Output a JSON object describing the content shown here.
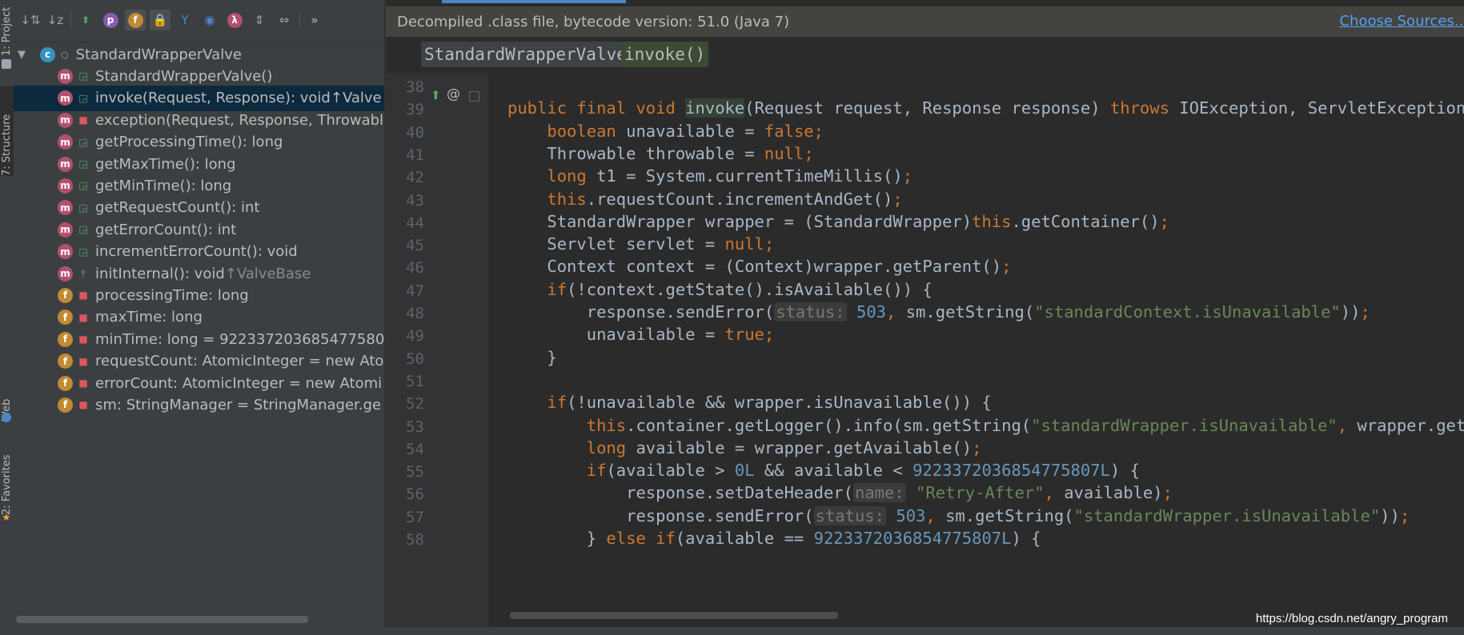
{
  "side_tabs": {
    "project": "1: Project",
    "structure": "7: Structure",
    "web": "Web",
    "favorites": "2: Favorites"
  },
  "structure_toolbar": [
    {
      "name": "sort-by-visibility-icon",
      "glyph": "↓⇅"
    },
    {
      "name": "sort-alphabetically-icon",
      "glyph": "↓z"
    },
    {
      "name": "show-inherited-icon",
      "glyph": "⬆"
    },
    {
      "name": "show-properties-icon",
      "glyph": "p"
    },
    {
      "name": "show-fields-icon",
      "glyph": "f"
    },
    {
      "name": "show-non-public-icon",
      "glyph": "🔒"
    },
    {
      "name": "show-anonymous-icon",
      "glyph": "Y"
    },
    {
      "name": "autoscroll-icon",
      "glyph": "◉"
    },
    {
      "name": "show-lambdas-icon",
      "glyph": "λ"
    },
    {
      "name": "expand-all-icon",
      "glyph": "⇕"
    },
    {
      "name": "collapse-all-icon",
      "glyph": "⇔"
    },
    {
      "name": "more-icon",
      "glyph": "»"
    }
  ],
  "tree": {
    "root": "StandardWrapperValve",
    "items": [
      {
        "kind": "m",
        "vis": "pub",
        "label": "StandardWrapperValve()",
        "extra": ""
      },
      {
        "kind": "m",
        "vis": "pub",
        "label": "invoke(Request, Response): void ",
        "extra": "↑Valve",
        "selected": true,
        "override": true
      },
      {
        "kind": "m",
        "vis": "priv",
        "label": "exception(Request, Response, Throwable",
        "extra": ""
      },
      {
        "kind": "m",
        "vis": "pub",
        "label": "getProcessingTime(): long",
        "extra": ""
      },
      {
        "kind": "m",
        "vis": "pub",
        "label": "getMaxTime(): long",
        "extra": ""
      },
      {
        "kind": "m",
        "vis": "pub",
        "label": "getMinTime(): long",
        "extra": ""
      },
      {
        "kind": "m",
        "vis": "pub",
        "label": "getRequestCount(): int",
        "extra": ""
      },
      {
        "kind": "m",
        "vis": "pub",
        "label": "getErrorCount(): int",
        "extra": ""
      },
      {
        "kind": "m",
        "vis": "pub",
        "label": "incrementErrorCount(): void",
        "extra": ""
      },
      {
        "kind": "m",
        "vis": "pkg",
        "label": "initInternal(): void ",
        "extra": "↑ValveBase"
      },
      {
        "kind": "f",
        "vis": "priv",
        "label": "processingTime: long",
        "extra": ""
      },
      {
        "kind": "f",
        "vis": "priv",
        "label": "maxTime: long",
        "extra": ""
      },
      {
        "kind": "f",
        "vis": "priv",
        "label": "minTime: long = 922337203685477580",
        "extra": ""
      },
      {
        "kind": "f",
        "vis": "priv",
        "label": "requestCount: AtomicInteger = new Ato",
        "extra": "",
        "final": true
      },
      {
        "kind": "f",
        "vis": "priv",
        "label": "errorCount: AtomicInteger = new Atomi",
        "extra": "",
        "final": true
      },
      {
        "kind": "f",
        "vis": "priv",
        "label": "sm: StringManager = StringManager.ge",
        "extra": "",
        "final": true
      }
    ]
  },
  "editor": {
    "banner": "Decompiled .class file, bytecode version: 51.0 (Java 7)",
    "choose_sources": "Choose Sources...",
    "breadcrumb": [
      "StandardWrapperValve",
      "invoke()"
    ],
    "lines": [
      {
        "n": "38",
        "segs": []
      },
      {
        "n": "39",
        "segs": [
          [
            "k",
            "public final void "
          ],
          [
            "m",
            "invoke"
          ],
          [
            "p",
            "(Request request, Response response) "
          ],
          [
            "k",
            "throws "
          ],
          [
            "p",
            "IOException, ServletException {"
          ]
        ]
      },
      {
        "n": "40",
        "segs": [
          [
            "p",
            "    "
          ],
          [
            "k",
            "boolean "
          ],
          [
            "p",
            "unavailable = "
          ],
          [
            "k",
            "false"
          ],
          [
            "k",
            ";"
          ]
        ]
      },
      {
        "n": "41",
        "segs": [
          [
            "p",
            "    Throwable throwable = "
          ],
          [
            "k",
            "null"
          ],
          [
            "k",
            ";"
          ]
        ]
      },
      {
        "n": "42",
        "segs": [
          [
            "p",
            "    "
          ],
          [
            "k",
            "long "
          ],
          [
            "p",
            "t1 = System.currentTimeMillis()"
          ],
          [
            "k",
            ";"
          ]
        ]
      },
      {
        "n": "43",
        "segs": [
          [
            "p",
            "    "
          ],
          [
            "k",
            "this"
          ],
          [
            "p",
            ".requestCount.incrementAndGet()"
          ],
          [
            "k",
            ";"
          ]
        ]
      },
      {
        "n": "44",
        "segs": [
          [
            "p",
            "    StandardWrapper wrapper = (StandardWrapper)"
          ],
          [
            "k",
            "this"
          ],
          [
            "p",
            ".getContainer()"
          ],
          [
            "k",
            ";"
          ]
        ]
      },
      {
        "n": "45",
        "segs": [
          [
            "p",
            "    Servlet servlet = "
          ],
          [
            "k",
            "null"
          ],
          [
            "k",
            ";"
          ]
        ]
      },
      {
        "n": "46",
        "segs": [
          [
            "p",
            "    Context context = (Context)wrapper.getParent()"
          ],
          [
            "k",
            ";"
          ]
        ]
      },
      {
        "n": "47",
        "segs": [
          [
            "p",
            "    "
          ],
          [
            "k",
            "if"
          ],
          [
            "p",
            "(!context.getState().isAvailable()) {"
          ]
        ]
      },
      {
        "n": "48",
        "segs": [
          [
            "p",
            "        response.sendError("
          ],
          [
            "h",
            "status:"
          ],
          [
            "n",
            " 503"
          ],
          [
            "k",
            ", "
          ],
          [
            "p",
            "sm.getString("
          ],
          [
            "s",
            "\"standardContext.isUnavailable\""
          ],
          [
            "p",
            "))"
          ],
          [
            "k",
            ";"
          ]
        ]
      },
      {
        "n": "49",
        "segs": [
          [
            "p",
            "        unavailable = "
          ],
          [
            "k",
            "true"
          ],
          [
            "k",
            ";"
          ]
        ]
      },
      {
        "n": "50",
        "segs": [
          [
            "p",
            "    }"
          ]
        ]
      },
      {
        "n": "51",
        "segs": []
      },
      {
        "n": "52",
        "segs": [
          [
            "p",
            "    "
          ],
          [
            "k",
            "if"
          ],
          [
            "p",
            "(!unavailable && wrapper.isUnavailable()) {"
          ]
        ]
      },
      {
        "n": "53",
        "segs": [
          [
            "p",
            "        "
          ],
          [
            "k",
            "this"
          ],
          [
            "p",
            ".container.getLogger().info(sm.getString("
          ],
          [
            "s",
            "\"standardWrapper.isUnavailable\""
          ],
          [
            "k",
            ", "
          ],
          [
            "p",
            "wrapper.getName()))"
          ],
          [
            "k",
            ";"
          ]
        ]
      },
      {
        "n": "54",
        "segs": [
          [
            "p",
            "        "
          ],
          [
            "k",
            "long "
          ],
          [
            "p",
            "available = wrapper.getAvailable()"
          ],
          [
            "k",
            ";"
          ]
        ]
      },
      {
        "n": "55",
        "segs": [
          [
            "p",
            "        "
          ],
          [
            "k",
            "if"
          ],
          [
            "p",
            "(available > "
          ],
          [
            "n",
            "0L "
          ],
          [
            "p",
            "&& available < "
          ],
          [
            "n",
            "9223372036854775807L"
          ],
          [
            "p",
            ") {"
          ]
        ]
      },
      {
        "n": "56",
        "segs": [
          [
            "p",
            "            response.setDateHeader("
          ],
          [
            "h",
            "name:"
          ],
          [
            "s",
            " \"Retry-After\""
          ],
          [
            "k",
            ", "
          ],
          [
            "p",
            "available)"
          ],
          [
            "k",
            ";"
          ]
        ]
      },
      {
        "n": "57",
        "segs": [
          [
            "p",
            "            response.sendError("
          ],
          [
            "h",
            "status:"
          ],
          [
            "n",
            " 503"
          ],
          [
            "k",
            ", "
          ],
          [
            "p",
            "sm.getString("
          ],
          [
            "s",
            "\"standardWrapper.isUnavailable\""
          ],
          [
            "p",
            "))"
          ],
          [
            "k",
            ";"
          ]
        ]
      },
      {
        "n": "58",
        "segs": [
          [
            "p",
            "        } "
          ],
          [
            "k",
            "else if"
          ],
          [
            "p",
            "(available == "
          ],
          [
            "n",
            "9223372036854775807L"
          ],
          [
            "p",
            ") {"
          ]
        ]
      }
    ]
  },
  "watermark": "https://blog.csdn.net/angry_program",
  "colors": {
    "keyword": "#cc7832",
    "number": "#6897bb",
    "string": "#6a8759",
    "plain": "#a9b7c6",
    "selection": "#0d293e"
  }
}
